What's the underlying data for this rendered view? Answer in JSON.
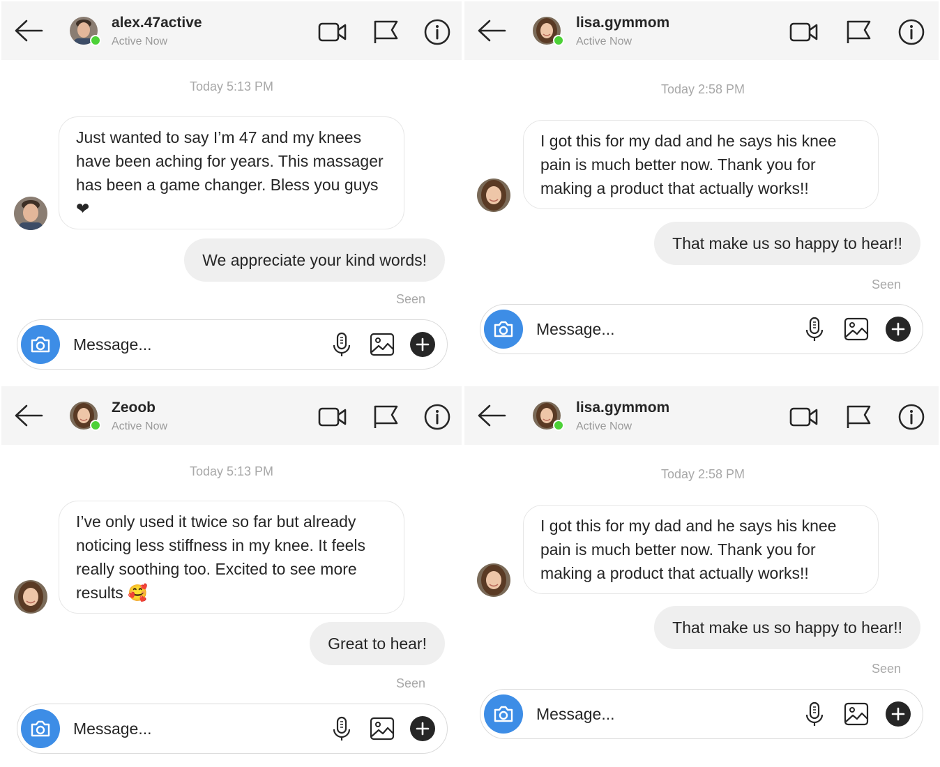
{
  "colors": {
    "header_bg": "#f5f5f5",
    "online": "#4cd137",
    "camera_button": "#3d8de6",
    "outgoing_bubble": "#efefef",
    "muted_text": "#a8a8a8"
  },
  "icons": [
    "back-arrow-icon",
    "video-camera-icon",
    "flag-icon",
    "info-icon",
    "camera-icon",
    "microphone-icon",
    "image-icon",
    "plus-icon"
  ],
  "panels": [
    {
      "username": "alex.47active",
      "status": "Active Now",
      "timestamp": "Today 5:13 PM",
      "incoming": "Just wanted to say I’m 47 and my knees have been aching for years. This massager has been a game changer. Bless you guys ❤",
      "outgoing": "We appreciate your kind words!",
      "seen": "Seen",
      "placeholder": "Message..."
    },
    {
      "username": "lisa.gymmom",
      "status": "Active Now",
      "timestamp": "Today 2:58 PM",
      "incoming": "I got this for my dad and he says his knee pain is much better now. Thank you for making a product that actually works!!",
      "outgoing": "That make us so happy to hear!!",
      "seen": "Seen",
      "placeholder": "Message..."
    },
    {
      "username": "Zeoob",
      "status": "Active Now",
      "timestamp": "Today 5:13 PM",
      "incoming": "I’ve only used it twice so far but already noticing less stiffness in my knee. It feels really soothing too. Excited to see more results 🥰",
      "outgoing": "Great to hear!",
      "seen": "Seen",
      "placeholder": "Message..."
    },
    {
      "username": "lisa.gymmom",
      "status": "Active Now",
      "timestamp": "Today 2:58 PM",
      "incoming": "I got this for my dad and he says his knee pain is much better now. Thank you for making a product that actually works!!",
      "outgoing": "That make us so happy to hear!!",
      "seen": "Seen",
      "placeholder": "Message..."
    }
  ]
}
